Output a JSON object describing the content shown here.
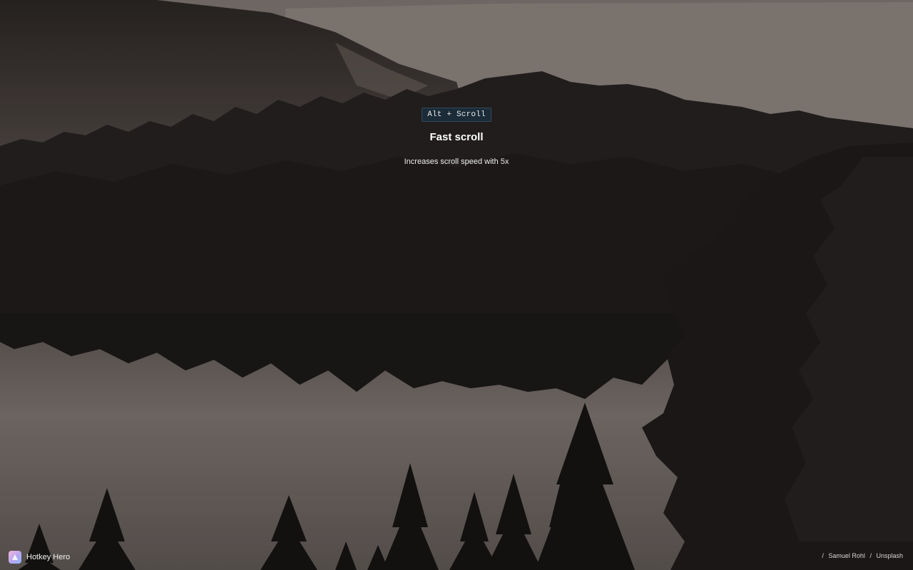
{
  "hotkey": {
    "keys": "Alt + Scroll",
    "title": "Fast scroll",
    "description": "Increases scroll speed with 5x"
  },
  "brand": {
    "name": "Hotkey Hero",
    "icon": "hotkey-hero-logo-icon"
  },
  "credit": {
    "separator": "/",
    "author": "Samuel Rohl",
    "source": "Unsplash"
  },
  "background": {
    "icon": "forest-lake-photo",
    "tones": {
      "sky": "#8e8680",
      "hills": "#4a4340",
      "forest": "#221f1e",
      "lake": "#6d6562"
    }
  }
}
